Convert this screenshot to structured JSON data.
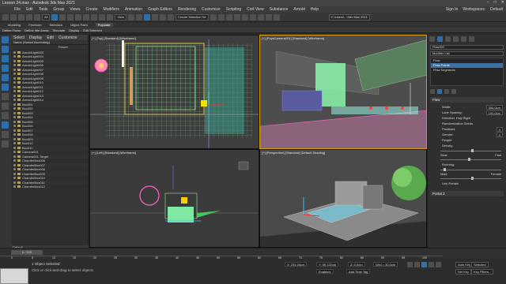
{
  "window": {
    "title": "Lesson 24.max - Autodesk 3ds Max 2021"
  },
  "menu": [
    "File",
    "Edit",
    "Tools",
    "Group",
    "Views",
    "Create",
    "Modifiers",
    "Animation",
    "Graph Editors",
    "Rendering",
    "Customize",
    "Scripting",
    "Civil View",
    "Substance",
    "Arnold",
    "Help"
  ],
  "menu_right": {
    "signin": "Sign In",
    "workspaces": "Workspaces:",
    "workspace_value": "Default"
  },
  "toolbar": {
    "selection_set": "Create Selection Se",
    "path": "C:\\Users\\...\\3ds Max 2021"
  },
  "ribbon_tabs": [
    "Modeling",
    "Freeform",
    "Selection",
    "Object Paint",
    "Populate"
  ],
  "ribbon_active": "Populate",
  "ribbon_items": [
    "Define Flows",
    "Define Idle Areas",
    "Simulate",
    "Display",
    "Edit Selected"
  ],
  "explorer": {
    "tabs": [
      "Select",
      "Display",
      "Edit",
      "Customize"
    ],
    "column_header": "Name (Sorted Ascending)",
    "flower_label": "Flower",
    "items": [
      "ArnoldLight003",
      "ArnoldLight004",
      "ArnoldLight005",
      "ArnoldLight006",
      "ArnoldLight007",
      "ArnoldLight008",
      "ArnoldLight009",
      "ArnoldLight010",
      "ArnoldLight011",
      "ArnoldLight012",
      "ArnoldLight013",
      "ArnoldLight014",
      "Box001",
      "Box002",
      "Box003",
      "Box004",
      "Box005",
      "Box006",
      "Box007",
      "Box008",
      "Box009",
      "Box010",
      "Box011",
      "Camera001",
      "Camera001.Target",
      "ChamferBox006",
      "ChamferBox007",
      "ChamferBox008",
      "ChamferBox009",
      "ChamferBox010",
      "ChamferBox011",
      "ChamferBox012"
    ],
    "layer": "Default"
  },
  "viewports": {
    "top": "[+] [Top] [Standard] [Wireframe]",
    "persp1": "[+] [PhysCamera001] [Standard] [Wireframe]",
    "left": "[+] [Left] [Standard] [Wireframe]",
    "persp2": "[+] [Perspective] [Standard] [Default Shading]"
  },
  "command_panel": {
    "object_name": "Flow001",
    "modifier_list": "Modifier List",
    "stack": [
      "Flow",
      "Flow Points",
      "Flow Segments"
    ],
    "stack_selected": "Flow Points",
    "rollout_flow": "Flow",
    "params": [
      {
        "label": "Width:",
        "value": "300,0cm"
      },
      {
        "label": "Lane Spacing:",
        "value": "100,0cm"
      }
    ],
    "direction": "Direction: Hug Right",
    "randomization_seeds": "Randomization Seeds",
    "seeds": [
      {
        "label": "Positions:",
        "value": "0"
      },
      {
        "label": "Gender:",
        "value": "0"
      }
    ],
    "people": "People",
    "density": "Density:",
    "slow": "Slow",
    "fast": "Fast",
    "running": "Running:",
    "male": "Male",
    "female": "Female",
    "link_portals": "Link Portals",
    "portal2": "Portal 2"
  },
  "timeline": {
    "frame": "0 / 100",
    "ticks": [
      "0",
      "5",
      "10",
      "15",
      "20",
      "25",
      "30",
      "35",
      "40",
      "45",
      "50",
      "55",
      "60",
      "65",
      "70",
      "75",
      "80",
      "85",
      "90",
      "95",
      "100"
    ]
  },
  "status": {
    "line1": "1 Object Selected",
    "line2": "Click or click-and-drag to select objects",
    "x": "X: 231,04cm",
    "y": "Y: 59,122cm",
    "z": "Z: 0,0cm",
    "grid": "Grid = 30,0cm",
    "add_time_tag": "Add Time Tag",
    "autokey": "Auto Key",
    "selected": "Selected",
    "setkey": "Set Key",
    "keyfilters": "Key Filters...",
    "enabled": "Enabled:"
  },
  "colors": {
    "accent": "#3d6fa3",
    "active_vp": "#d9a400",
    "grass": "#7bd88a",
    "wire": "#ff66cc"
  }
}
